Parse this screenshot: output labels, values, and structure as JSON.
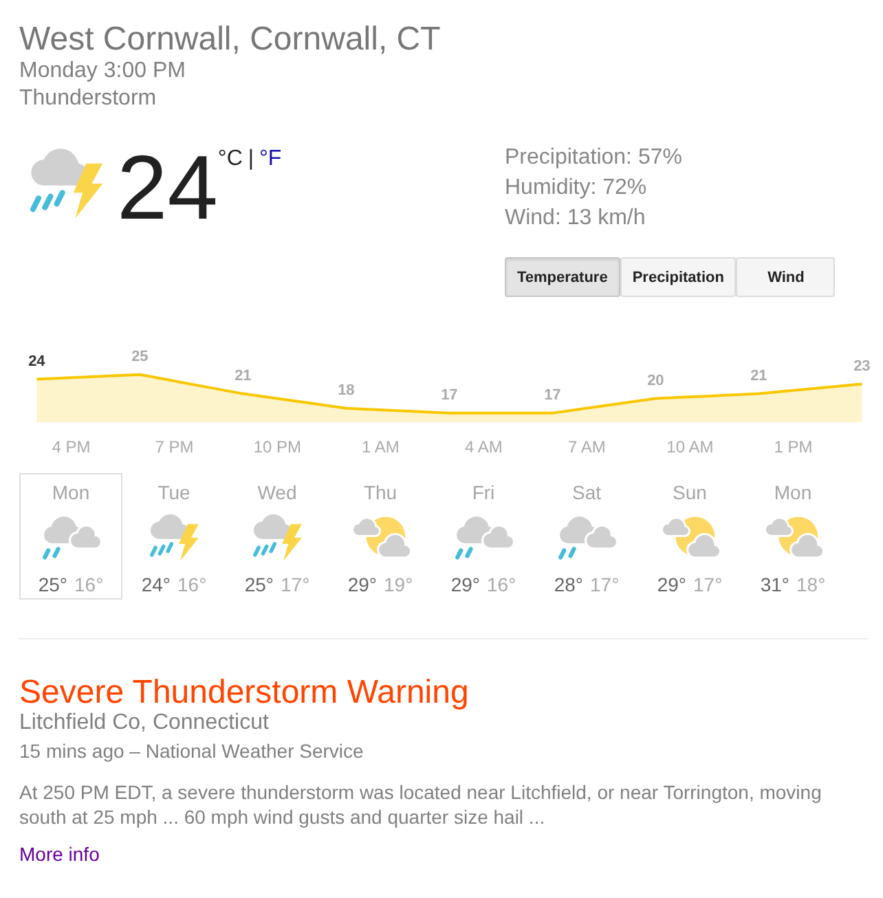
{
  "location": {
    "title": "West Cornwall, Cornwall, CT",
    "time": "Monday 3:00 PM",
    "condition": "Thunderstorm"
  },
  "current": {
    "temperature": "24",
    "units": [
      {
        "label": "°C",
        "selected": true
      },
      {
        "label": "°F",
        "selected": false
      }
    ],
    "unit_separator": "|"
  },
  "details": [
    "Precipitation: 57%",
    "Humidity: 72%",
    "Wind: 13 km/h"
  ],
  "tabs": [
    {
      "label": "Temperature",
      "selected": true
    },
    {
      "label": "Precipitation",
      "selected": false
    },
    {
      "label": "Wind",
      "selected": false
    }
  ],
  "hourly": {
    "chart_data": {
      "type": "area",
      "categories": [
        null,
        "4 PM",
        null,
        null,
        "7 PM",
        null,
        null,
        "10 PM",
        null,
        null,
        "1 AM",
        null,
        null,
        "4 AM",
        null,
        null,
        "7 AM",
        null,
        null,
        "10 AM",
        null,
        null,
        "1 PM",
        null,
        null
      ],
      "series": [
        {
          "color": "#f8c700",
          "values": [
            24,
            null,
            null,
            25,
            null,
            null,
            21,
            null,
            null,
            18,
            null,
            null,
            17,
            null,
            null,
            17,
            null,
            null,
            20,
            null,
            null,
            21,
            null,
            null,
            23
          ]
        }
      ],
      "data_labels": true
    }
  },
  "days": [
    {
      "name": "Mon",
      "kind": "showers",
      "high": "25°",
      "low": "16°",
      "selected": true
    },
    {
      "name": "Tue",
      "kind": "thunderstorm",
      "high": "24°",
      "low": "16°",
      "selected": false
    },
    {
      "name": "Wed",
      "kind": "thunderstorm",
      "high": "25°",
      "low": "17°",
      "selected": false
    },
    {
      "name": "Thu",
      "kind": "partly-cloudy",
      "high": "29°",
      "low": "19°",
      "selected": false
    },
    {
      "name": "Fri",
      "kind": "showers",
      "high": "29°",
      "low": "16°",
      "selected": false
    },
    {
      "name": "Sat",
      "kind": "showers",
      "high": "28°",
      "low": "17°",
      "selected": false
    },
    {
      "name": "Sun",
      "kind": "partly-cloudy",
      "high": "29°",
      "low": "17°",
      "selected": false
    },
    {
      "name": "Mon",
      "kind": "partly-cloudy",
      "high": "31°",
      "low": "18°",
      "selected": false
    }
  ],
  "alert": {
    "title": "Severe Thunderstorm Warning",
    "area": "Litchfield Co, Connecticut",
    "source": "15 mins ago – National Weather Service",
    "summary": "At 250 PM EDT, a severe thunderstorm was located near Litchfield, or near Torrington, moving south at 25 mph ... 60 mph wind gusts and quarter size hail ...",
    "link": "More info"
  }
}
